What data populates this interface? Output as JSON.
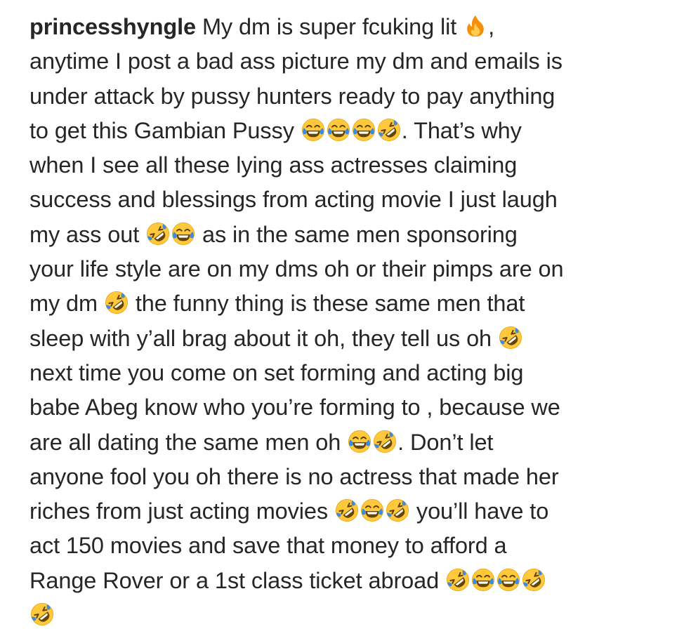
{
  "post": {
    "username": "princesshyngle",
    "lines": [
      [
        {
          "t": "text",
          "v": " My dm is super fcuking lit "
        },
        {
          "t": "emoji",
          "name": "fire-icon"
        },
        {
          "t": "text",
          "v": ","
        }
      ],
      [
        {
          "t": "text",
          "v": "anytime I post a bad ass picture my dm and emails is"
        }
      ],
      [
        {
          "t": "text",
          "v": "under attack by pussy hunters ready to pay anything"
        }
      ],
      [
        {
          "t": "text",
          "v": "to get this Gambian Pussy "
        },
        {
          "t": "emoji",
          "name": "tears-of-joy-icon"
        },
        {
          "t": "emoji",
          "name": "tears-of-joy-icon"
        },
        {
          "t": "emoji",
          "name": "tears-of-joy-icon"
        },
        {
          "t": "emoji",
          "name": "rolling-laughing-icon"
        },
        {
          "t": "text",
          "v": ". That’s why"
        }
      ],
      [
        {
          "t": "text",
          "v": "when I see all these lying ass actresses claiming"
        }
      ],
      [
        {
          "t": "text",
          "v": "success and blessings from acting movie I just laugh"
        }
      ],
      [
        {
          "t": "text",
          "v": "my ass out "
        },
        {
          "t": "emoji",
          "name": "rolling-laughing-icon"
        },
        {
          "t": "emoji",
          "name": "tears-of-joy-icon"
        },
        {
          "t": "text",
          "v": " as in the same men sponsoring"
        }
      ],
      [
        {
          "t": "text",
          "v": "your life style are on my dms oh or their pimps are on"
        }
      ],
      [
        {
          "t": "text",
          "v": "my dm "
        },
        {
          "t": "emoji",
          "name": "rolling-laughing-icon"
        },
        {
          "t": "text",
          "v": " the funny thing is these same men that"
        }
      ],
      [
        {
          "t": "text",
          "v": "sleep with y’all brag about it oh, they tell us oh "
        },
        {
          "t": "emoji",
          "name": "rolling-laughing-icon"
        }
      ],
      [
        {
          "t": "text",
          "v": "next time you come on set forming and acting big"
        }
      ],
      [
        {
          "t": "text",
          "v": "babe Abeg know who you’re forming to , because we"
        }
      ],
      [
        {
          "t": "text",
          "v": "are all dating the same men oh "
        },
        {
          "t": "emoji",
          "name": "tears-of-joy-icon"
        },
        {
          "t": "emoji",
          "name": "rolling-laughing-icon"
        },
        {
          "t": "text",
          "v": ". Don’t let"
        }
      ],
      [
        {
          "t": "text",
          "v": "anyone fool you oh there is no actress that made her"
        }
      ],
      [
        {
          "t": "text",
          "v": "riches from just acting movies "
        },
        {
          "t": "emoji",
          "name": "rolling-laughing-icon"
        },
        {
          "t": "emoji",
          "name": "tears-of-joy-icon"
        },
        {
          "t": "emoji",
          "name": "rolling-laughing-icon"
        },
        {
          "t": "text",
          "v": " you’ll have to"
        }
      ],
      [
        {
          "t": "text",
          "v": "act 150 movies and save that money to afford a"
        }
      ],
      [
        {
          "t": "text",
          "v": "Range Rover or a 1st class ticket abroad "
        },
        {
          "t": "emoji",
          "name": "rolling-laughing-icon"
        },
        {
          "t": "emoji",
          "name": "tears-of-joy-icon"
        },
        {
          "t": "emoji",
          "name": "tears-of-joy-icon"
        },
        {
          "t": "emoji",
          "name": "rolling-laughing-icon"
        }
      ],
      [
        {
          "t": "emoji",
          "name": "rolling-laughing-icon"
        }
      ]
    ]
  },
  "colors": {
    "text": "#262626",
    "emoji_face": "#FFC83D",
    "emoji_tear": "#3B8BE0",
    "fire_outer": "#F4900C",
    "fire_inner": "#FFCC4D"
  }
}
